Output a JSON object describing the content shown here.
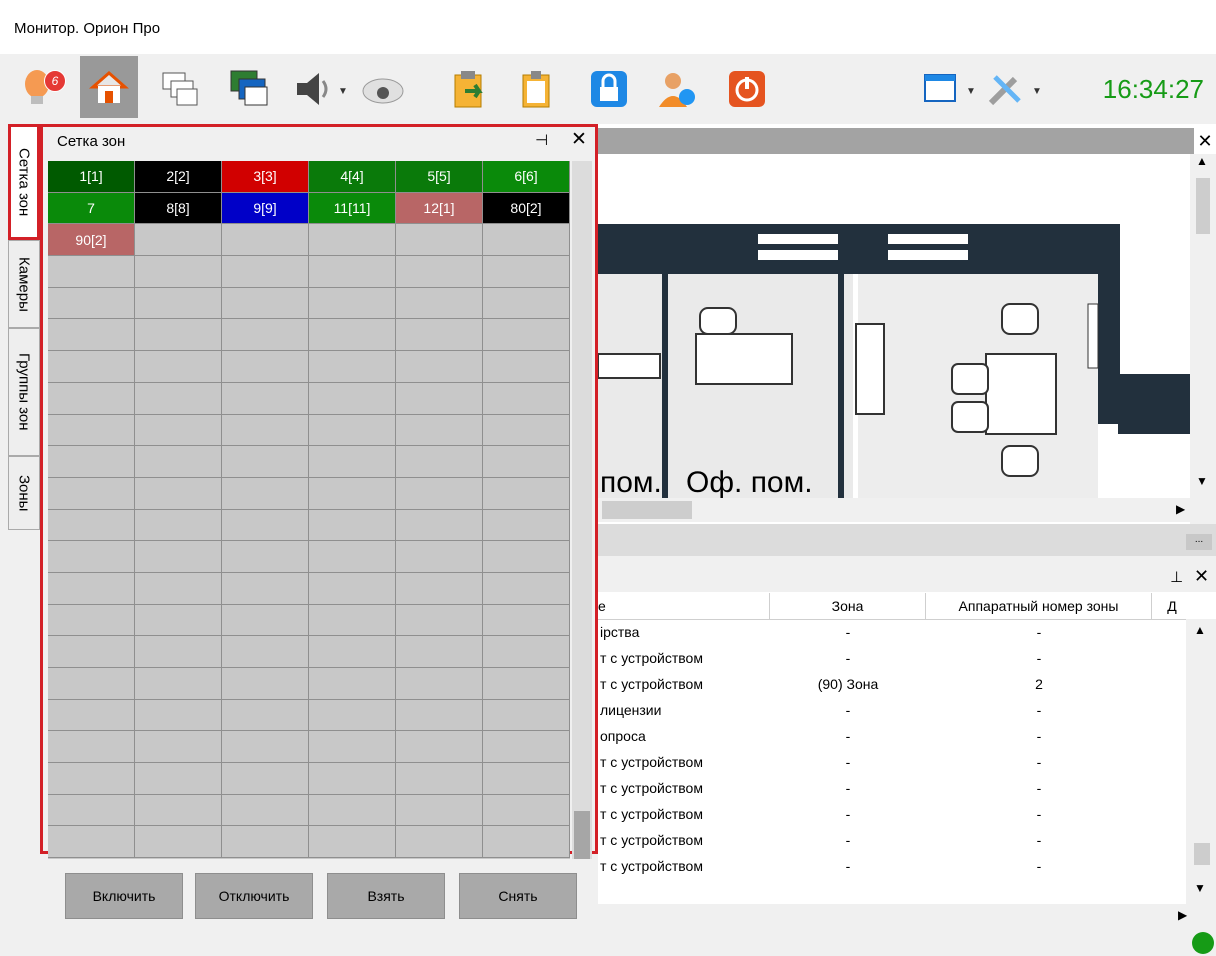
{
  "window": {
    "title": "Монитор. Орион Про"
  },
  "toolbar": {
    "alarm_badge": "6",
    "clock": "16:34:27",
    "icons": [
      "alarm-bulb-icon",
      "home-icon",
      "windows-icon",
      "plans-icon",
      "sound-icon",
      "camera-icon",
      "export-icon",
      "clipboard-icon",
      "lock-icon",
      "user-switch-icon",
      "power-icon",
      "window-layout-icon",
      "settings-tools-icon"
    ]
  },
  "tabs": {
    "zone_grid": "Сетка зон",
    "cameras": "Камеры",
    "zone_groups": "Группы зон",
    "zones": "Зоны"
  },
  "zone_panel": {
    "title": "Сетка зон",
    "cells": [
      {
        "label": "1[1]",
        "color": "#005a00"
      },
      {
        "label": "2[2]",
        "color": "#000000"
      },
      {
        "label": "3[3]",
        "color": "#d10000"
      },
      {
        "label": "4[4]",
        "color": "#0a7a0a"
      },
      {
        "label": "5[5]",
        "color": "#0a7a0a"
      },
      {
        "label": "6[6]",
        "color": "#0a8a0a"
      },
      {
        "label": "7",
        "color": "#0a8a0a"
      },
      {
        "label": "8[8]",
        "color": "#000000"
      },
      {
        "label": "9[9]",
        "color": "#0000c8"
      },
      {
        "label": "11[11]",
        "color": "#0a8a0a"
      },
      {
        "label": "12[1]",
        "color": "#b86666"
      },
      {
        "label": "80[2]",
        "color": "#000000"
      },
      {
        "label": "90[2]",
        "color": "#b86666"
      }
    ],
    "buttons": {
      "enable": "Включить",
      "disable": "Отключить",
      "arm": "Взять",
      "disarm": "Снять"
    }
  },
  "plan": {
    "labels": [
      "пом.",
      "Оф. пом."
    ]
  },
  "events": {
    "columns": {
      "event": "е",
      "zone": "Зона",
      "hw_zone": "Аппаратный номер зоны",
      "more": "Д"
    },
    "rows": [
      {
        "event": "ірства",
        "zone": "-",
        "hw": "-"
      },
      {
        "event": "т с устройством",
        "zone": "-",
        "hw": "-"
      },
      {
        "event": "т с устройством",
        "zone": "(90) Зона",
        "hw": "2"
      },
      {
        "event": "лицензии",
        "zone": "-",
        "hw": "-"
      },
      {
        "event": "опроса",
        "zone": "-",
        "hw": "-"
      },
      {
        "event": "т с устройством",
        "zone": "-",
        "hw": "-"
      },
      {
        "event": "т с устройством",
        "zone": "-",
        "hw": "-"
      },
      {
        "event": "т с устройством",
        "zone": "-",
        "hw": "-"
      },
      {
        "event": "т с устройством",
        "zone": "-",
        "hw": "-"
      },
      {
        "event": "т с устройством",
        "zone": "-",
        "hw": "-"
      }
    ]
  },
  "status": {
    "connection_color": "#169b16"
  }
}
